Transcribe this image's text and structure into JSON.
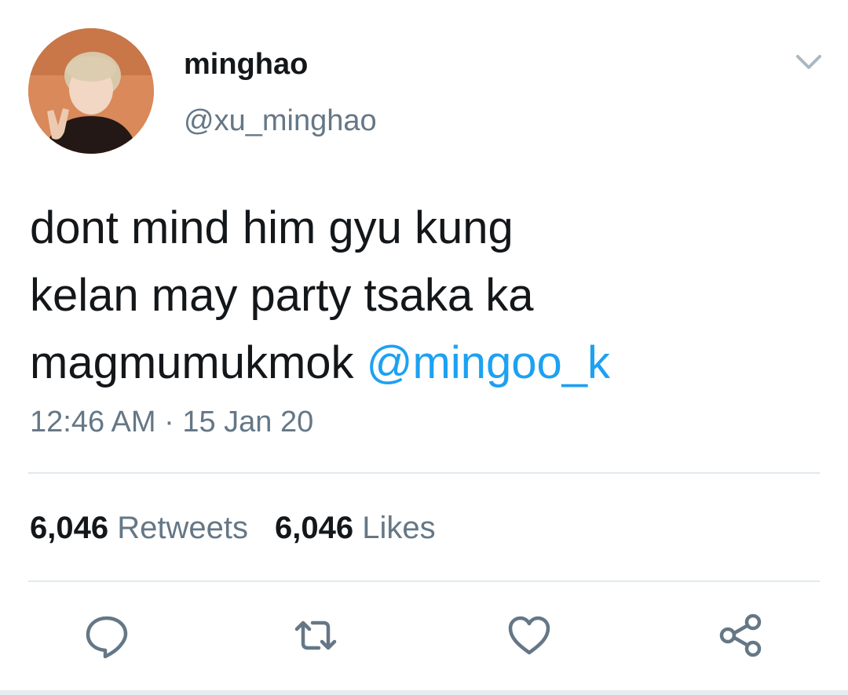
{
  "tweet": {
    "author": {
      "display_name": "minghao",
      "handle": "@xu_minghao",
      "avatar_icon": "profile-photo"
    },
    "menu_icon": "chevron-down-icon",
    "text_lines": [
      "dont mind him gyu kung",
      "kelan may party tsaka ka",
      "magmumukmok "
    ],
    "mention": "@mingoo_k",
    "timestamp": "12:46 AM · 15 Jan 20",
    "stats": {
      "retweets_count": "6,046",
      "retweets_label": "Retweets",
      "likes_count": "6,046",
      "likes_label": "Likes"
    },
    "actions": [
      {
        "name": "reply",
        "icon": "reply-icon"
      },
      {
        "name": "retweet",
        "icon": "retweet-icon"
      },
      {
        "name": "like",
        "icon": "heart-icon"
      },
      {
        "name": "share",
        "icon": "share-icon"
      }
    ]
  },
  "colors": {
    "text": "#14171a",
    "secondary": "#657786",
    "link": "#1da1f2",
    "divider": "#e1e8ed"
  }
}
